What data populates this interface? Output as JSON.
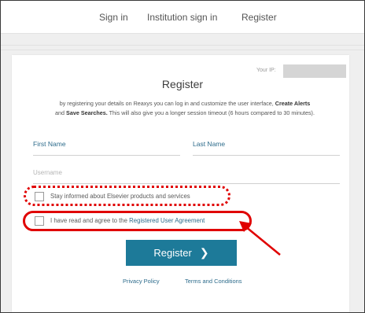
{
  "nav": {
    "sign_in": "Sign in",
    "institution_sign_in": "Institution sign in",
    "register": "Register"
  },
  "ip": {
    "label": "Your IP:"
  },
  "form": {
    "title": "Register",
    "description_prefix": "by registering your details on Reaxys you can log in and customize the user interface,",
    "create_alerts": "Create Alerts",
    "and": "and",
    "save_searches": "Save Searches.",
    "description_suffix": "This will also give you a longer session timeout (6 hours compared to 30 minutes).",
    "first_name_label": "First Name",
    "last_name_label": "Last Name",
    "username_label": "Username",
    "checkbox_stay_informed": "Stay informed about Elsevier products and services",
    "checkbox_agree_prefix": "I have read and agree to the",
    "checkbox_agree_link": "Registered User Agreement",
    "register_button": "Register",
    "chevron": "❯"
  },
  "footer": {
    "privacy_policy": "Privacy Policy",
    "terms_and_conditions": "Terms and Conditions"
  },
  "colors": {
    "accent": "#1d7a99",
    "link": "#2e6c8c",
    "annotation": "#e00000"
  }
}
